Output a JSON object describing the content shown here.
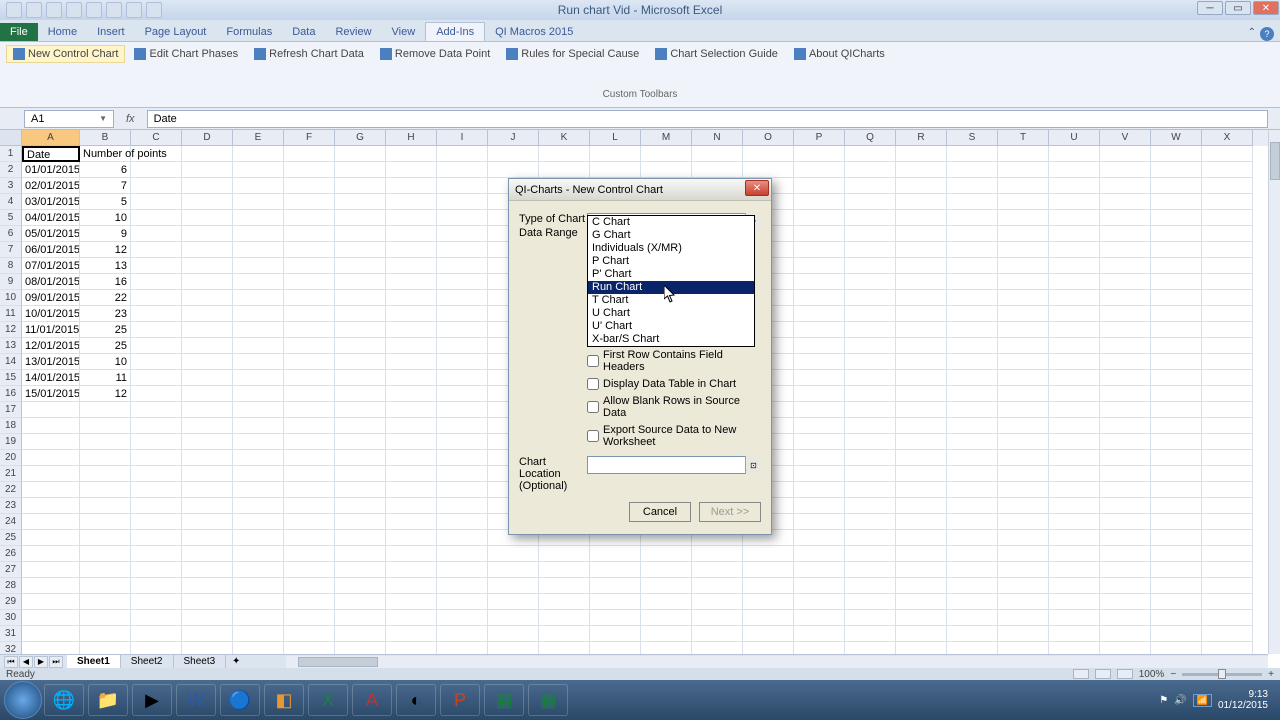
{
  "window": {
    "title": "Run chart Vid - Microsoft Excel"
  },
  "tabs": {
    "file": "File",
    "items": [
      "Home",
      "Insert",
      "Page Layout",
      "Formulas",
      "Data",
      "Review",
      "View",
      "Add-Ins",
      "QI Macros 2015"
    ],
    "active_index": 7
  },
  "ribbon": {
    "buttons": [
      "New Control Chart",
      "Edit Chart Phases",
      "Refresh Chart Data",
      "Remove Data Point",
      "Rules for Special Cause",
      "Chart Selection Guide",
      "About QICharts"
    ],
    "group_label": "Custom Toolbars"
  },
  "namebox": "A1",
  "formula": "Date",
  "columns": [
    "A",
    "B",
    "C",
    "D",
    "E",
    "F",
    "G",
    "H",
    "I",
    "J",
    "K",
    "L",
    "M",
    "N",
    "O",
    "P",
    "Q",
    "R",
    "S",
    "T",
    "U",
    "V",
    "W",
    "X"
  ],
  "data_rows": [
    {
      "r": "1",
      "a": "Date",
      "b": "Number of points"
    },
    {
      "r": "2",
      "a": "01/01/2015",
      "b": "6"
    },
    {
      "r": "3",
      "a": "02/01/2015",
      "b": "7"
    },
    {
      "r": "4",
      "a": "03/01/2015",
      "b": "5"
    },
    {
      "r": "5",
      "a": "04/01/2015",
      "b": "10"
    },
    {
      "r": "6",
      "a": "05/01/2015",
      "b": "9"
    },
    {
      "r": "7",
      "a": "06/01/2015",
      "b": "12"
    },
    {
      "r": "8",
      "a": "07/01/2015",
      "b": "13"
    },
    {
      "r": "9",
      "a": "08/01/2015",
      "b": "16"
    },
    {
      "r": "10",
      "a": "09/01/2015",
      "b": "22"
    },
    {
      "r": "11",
      "a": "10/01/2015",
      "b": "23"
    },
    {
      "r": "12",
      "a": "11/01/2015",
      "b": "25"
    },
    {
      "r": "13",
      "a": "12/01/2015",
      "b": "25"
    },
    {
      "r": "14",
      "a": "13/01/2015",
      "b": "10"
    },
    {
      "r": "15",
      "a": "14/01/2015",
      "b": "11"
    },
    {
      "r": "16",
      "a": "15/01/2015",
      "b": "12"
    }
  ],
  "empty_rows": [
    "17",
    "18",
    "19",
    "20",
    "21",
    "22",
    "23",
    "24",
    "25",
    "26",
    "27",
    "28",
    "29",
    "30",
    "31",
    "32"
  ],
  "sheets": {
    "items": [
      "Sheet1",
      "Sheet2",
      "Sheet3"
    ],
    "active": 0
  },
  "status": {
    "text": "Ready",
    "zoom": "100%"
  },
  "dialog": {
    "title": "QI-Charts - New Control Chart",
    "type_label": "Type of Chart",
    "type_value": "",
    "range_label": "Data Range",
    "dropdown": [
      "C Chart",
      "G Chart",
      "Individuals (X/MR)",
      "P Chart",
      "P' Chart",
      "Run Chart",
      "T Chart",
      "U Chart",
      "U' Chart",
      "X-bar/S Chart"
    ],
    "highlighted_index": 5,
    "check1": "First Row Contains Field Headers",
    "check2": "Display Data Table in Chart",
    "check3": "Allow Blank Rows in Source Data",
    "check4": "Export Source Data to New Worksheet",
    "loc_label1": "Chart Location",
    "loc_label2": "(Optional)",
    "cancel": "Cancel",
    "next": "Next >>"
  },
  "tray": {
    "time": "9:13",
    "date": "01/12/2015",
    "vol": "🔊"
  }
}
